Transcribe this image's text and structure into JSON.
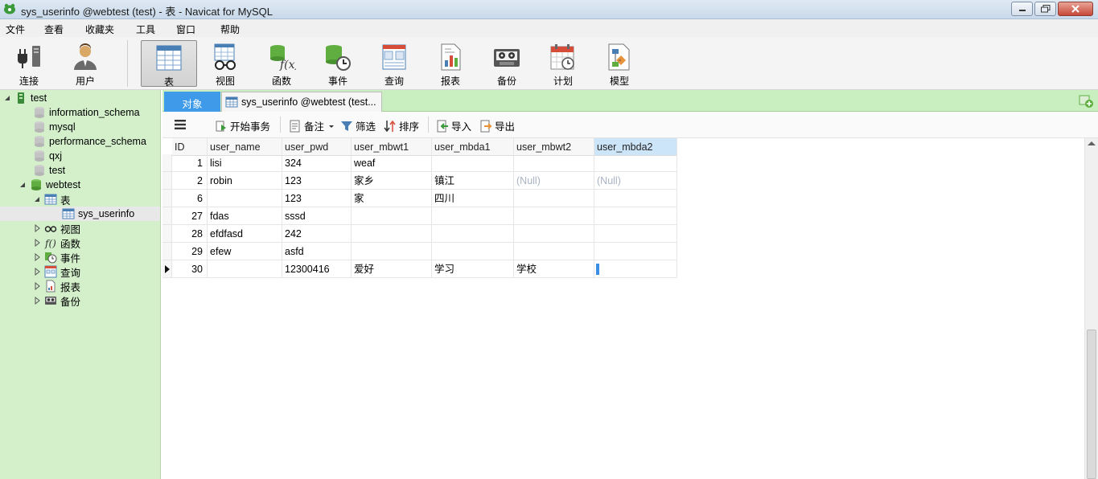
{
  "window": {
    "title": "sys_userinfo @webtest (test) - 表 - Navicat for MySQL"
  },
  "menu": [
    "文件",
    "查看",
    "收藏夹",
    "工具",
    "窗口",
    "帮助"
  ],
  "toolbar": [
    {
      "label": "连接",
      "icon": "plug-icon"
    },
    {
      "label": "用户",
      "icon": "user-icon"
    },
    {
      "label": "表",
      "icon": "table-icon",
      "active": true
    },
    {
      "label": "视图",
      "icon": "view-glasses-icon"
    },
    {
      "label": "函数",
      "icon": "function-icon"
    },
    {
      "label": "事件",
      "icon": "event-clock-icon"
    },
    {
      "label": "查询",
      "icon": "query-icon"
    },
    {
      "label": "报表",
      "icon": "report-icon"
    },
    {
      "label": "备份",
      "icon": "backup-tape-icon"
    },
    {
      "label": "计划",
      "icon": "calendar-icon"
    },
    {
      "label": "模型",
      "icon": "model-icon"
    }
  ],
  "sidebar": {
    "connection": "test",
    "databases": [
      "information_schema",
      "mysql",
      "performance_schema",
      "qxj",
      "test"
    ],
    "open_database": "webtest",
    "tables_folder": "表",
    "selected_table": "sys_userinfo",
    "folders": [
      "视图",
      "函数",
      "事件",
      "查询",
      "报表",
      "备份"
    ]
  },
  "tabs": {
    "objects": "对象",
    "document": "sys_userinfo @webtest (test..."
  },
  "grid_toolbar": {
    "begin_transaction": "开始事务",
    "memo": "备注",
    "filter": "筛选",
    "sort": "排序",
    "import": "导入",
    "export": "导出"
  },
  "table": {
    "columns": [
      "ID",
      "user_name",
      "user_pwd",
      "user_mbwt1",
      "user_mbda1",
      "user_mbwt2",
      "user_mbda2"
    ],
    "rows": [
      [
        "1",
        "lisi",
        "324",
        "weaf",
        "",
        "",
        ""
      ],
      [
        "2",
        "robin",
        "123",
        "家乡",
        "镇江",
        "(Null)",
        "(Null)"
      ],
      [
        "6",
        "",
        "123",
        "家",
        "四川",
        "",
        ""
      ],
      [
        "27",
        " fdas",
        "sssd",
        "",
        "",
        "",
        ""
      ],
      [
        "28",
        "efdfasd",
        "242",
        "",
        "",
        "",
        ""
      ],
      [
        "29",
        "efew",
        "asfd",
        "",
        "",
        "",
        ""
      ],
      [
        "30",
        "",
        "12300416",
        "爱好",
        "学习",
        "学校",
        ""
      ]
    ],
    "current_row": 6
  },
  "colors": {
    "sidebar_bg": "#d3f0cb",
    "tab_active": "#3f9be9",
    "selection": "#3a8ee6",
    "null_text": "#a9b3c4"
  }
}
